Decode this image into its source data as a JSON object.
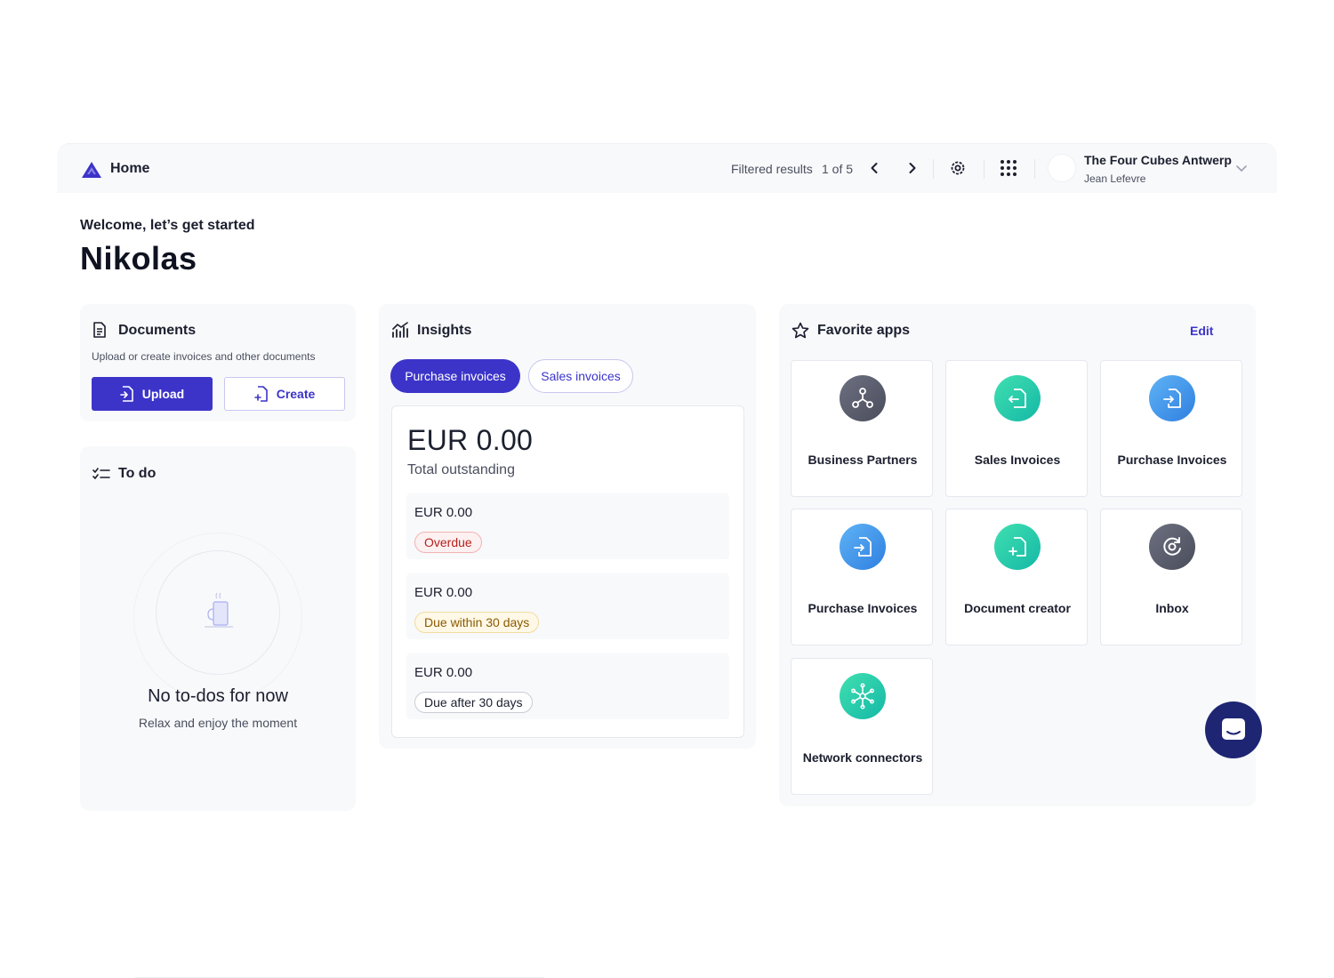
{
  "header": {
    "title": "Home",
    "filtered_label": "Filtered results",
    "filtered_count": "1 of 5",
    "company": "The Four Cubes Antwerp",
    "user": "Jean Lefevre"
  },
  "welcome": {
    "greeting": "Welcome, let’s get started",
    "name": "Nikolas"
  },
  "documents": {
    "title": "Documents",
    "subtitle": "Upload or create invoices and other documents",
    "upload_label": "Upload",
    "create_label": "Create"
  },
  "todo": {
    "title": "To do",
    "empty_title": "No to-dos for now",
    "empty_subtitle": "Relax and enjoy the moment"
  },
  "insights": {
    "title": "Insights",
    "tabs": [
      {
        "label": "Purchase invoices",
        "active": true
      },
      {
        "label": "Sales invoices",
        "active": false
      }
    ],
    "total_amount": "EUR 0.00",
    "total_label": "Total outstanding",
    "buckets": [
      {
        "amount": "EUR 0.00",
        "badge": "Overdue"
      },
      {
        "amount": "EUR 0.00",
        "badge": "Due within 30 days"
      },
      {
        "amount": "EUR 0.00",
        "badge": "Due after 30 days"
      }
    ]
  },
  "favorites": {
    "title": "Favorite apps",
    "edit_label": "Edit",
    "apps": [
      {
        "label": "Business Partners",
        "icon": "network-node-icon"
      },
      {
        "label": "Sales Invoices",
        "icon": "file-export-icon"
      },
      {
        "label": "Purchase Invoices",
        "icon": "file-import-icon"
      },
      {
        "label": "Purchase Invoices",
        "icon": "file-import-icon"
      },
      {
        "label": "Document creator",
        "icon": "file-plus-icon"
      },
      {
        "label": "Inbox",
        "icon": "inbox-cycle-icon"
      },
      {
        "label": "Network connectors",
        "icon": "snowflake-network-icon"
      }
    ]
  },
  "colors": {
    "primary": "#3c34c9",
    "chat_fab": "#1e2573"
  }
}
